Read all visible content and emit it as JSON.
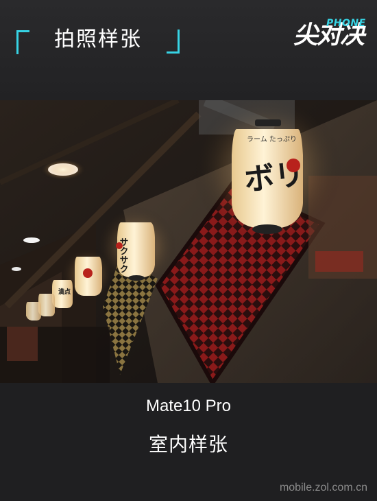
{
  "header": {
    "title": "拍照样张",
    "logo": {
      "main": "尖对决",
      "tag": "PHONE"
    },
    "accent_color": "#37d3e4"
  },
  "photo": {
    "lantern_texts": [
      "ボリ",
      "ラーム たっぷり",
      "サクサク",
      "満点"
    ]
  },
  "caption": {
    "model": "Mate10 Pro",
    "subtitle": "室内样张"
  },
  "watermark": "mobile.zol.com.cn"
}
